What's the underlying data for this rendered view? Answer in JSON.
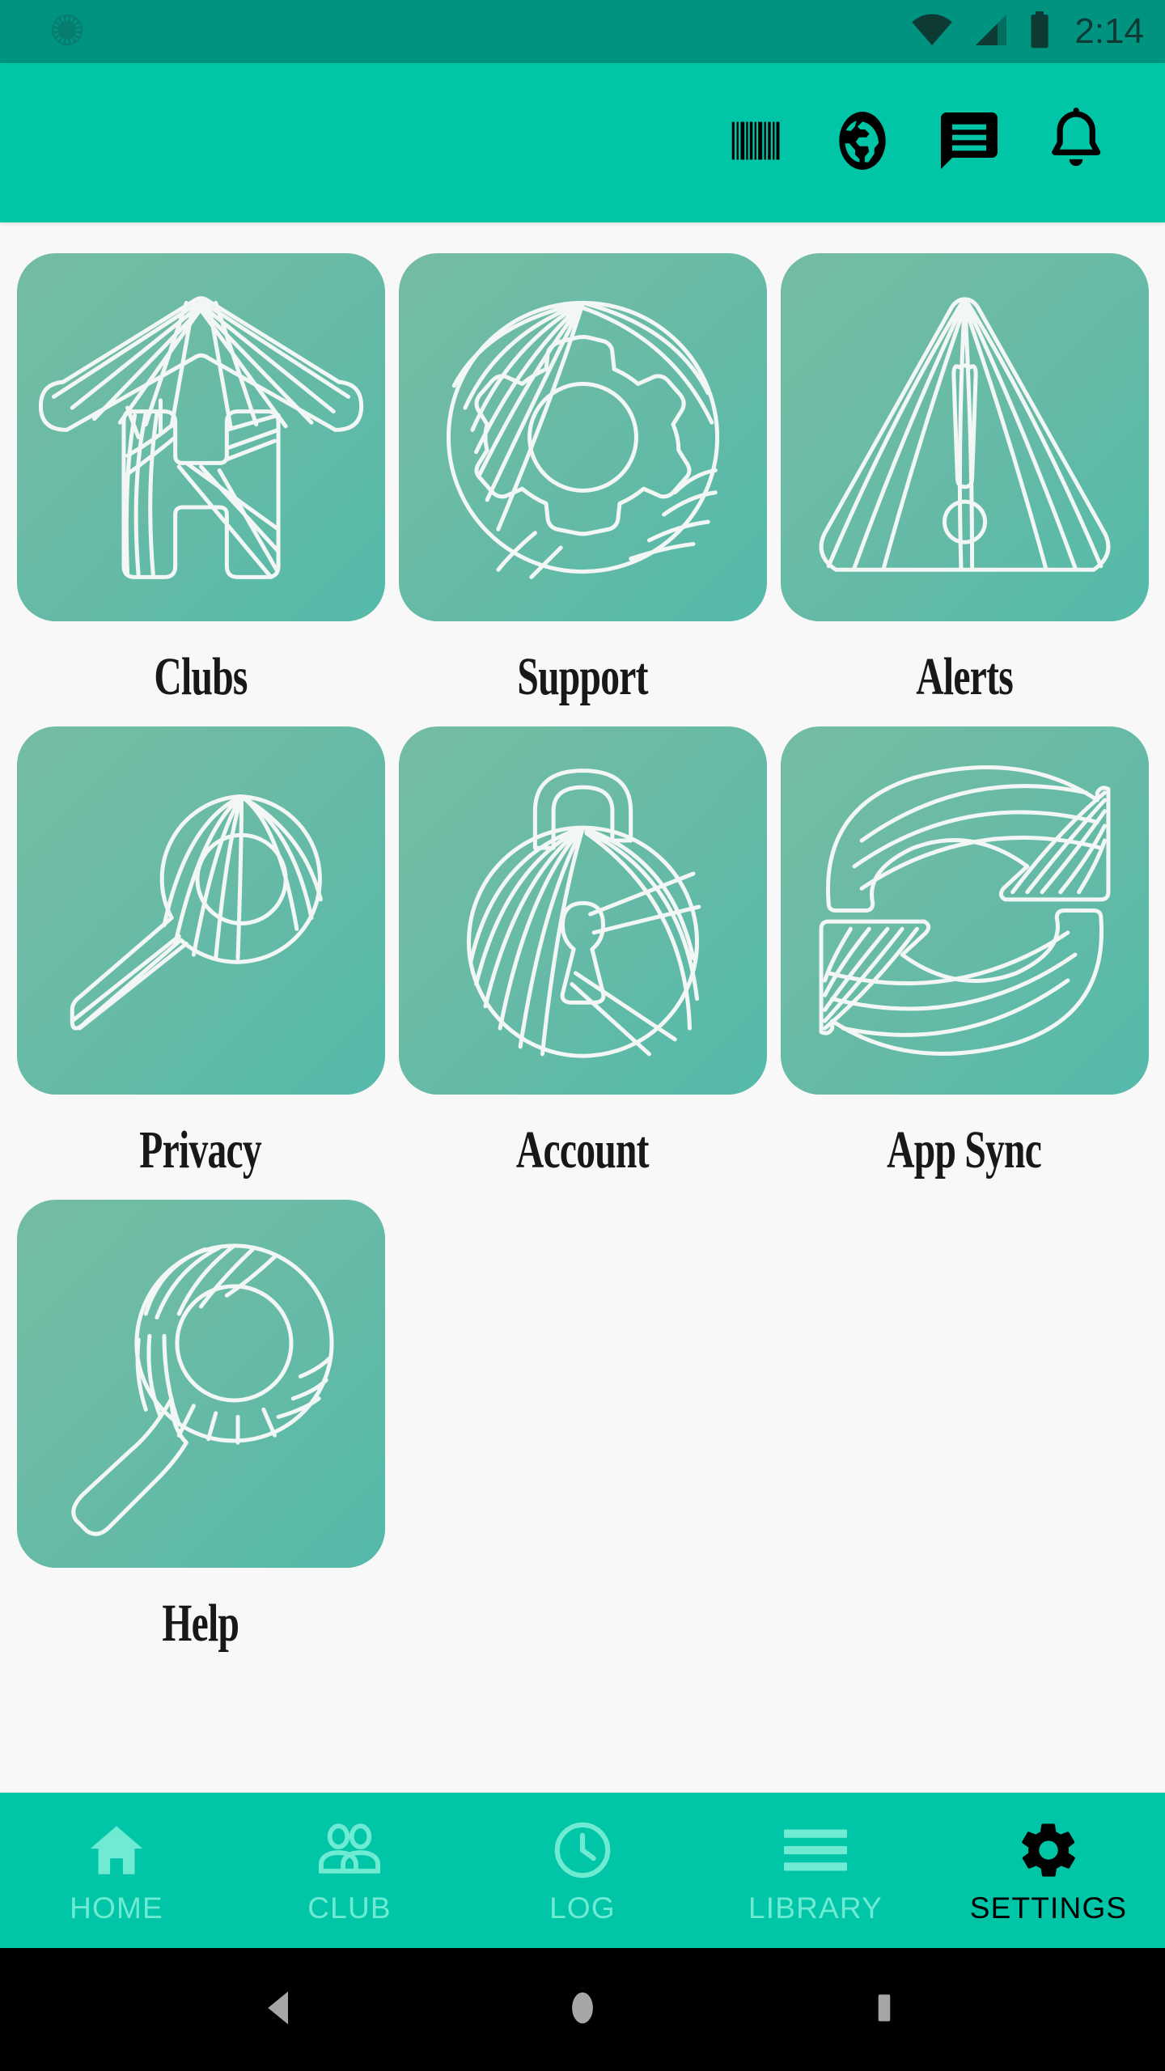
{
  "status_bar": {
    "time": "2:14",
    "background": "#009380",
    "icons": {
      "notification": "sync-circle-icon",
      "wifi": "wifi-icon",
      "signal": "cell-signal-icon",
      "battery": "battery-full-icon"
    }
  },
  "toolbar": {
    "background": "#00C6A7",
    "actions": [
      {
        "name": "barcode-icon",
        "label": "Barcode"
      },
      {
        "name": "globe-icon",
        "label": "Public"
      },
      {
        "name": "chat-icon",
        "label": "Messages"
      },
      {
        "name": "bell-icon",
        "label": "Notifications"
      }
    ]
  },
  "content": {
    "background": "#F7F8F7",
    "tile_gradient_from": "#74BCA3",
    "tile_gradient_to": "#55B9A9",
    "tiles": [
      {
        "label": "Clubs",
        "icon": "house-icon"
      },
      {
        "label": "Support",
        "icon": "gear-icon"
      },
      {
        "label": "Alerts",
        "icon": "warning-triangle-icon"
      },
      {
        "label": "Privacy",
        "icon": "key-icon"
      },
      {
        "label": "Account",
        "icon": "padlock-icon"
      },
      {
        "label": "App Sync",
        "icon": "sync-arrows-icon"
      },
      {
        "label": "Help",
        "icon": "magnifier-icon"
      }
    ]
  },
  "bottom_nav": {
    "background": "#00C6A7",
    "inactive_color": "#6FEBD4",
    "active_color": "#000000",
    "items": [
      {
        "label": "HOME",
        "icon": "home-icon",
        "active": false
      },
      {
        "label": "CLUB",
        "icon": "people-icon",
        "active": false
      },
      {
        "label": "LOG",
        "icon": "clock-icon",
        "active": false
      },
      {
        "label": "LIBRARY",
        "icon": "list-icon",
        "active": false
      },
      {
        "label": "SETTINGS",
        "icon": "gear-icon",
        "active": true
      }
    ]
  },
  "system_nav": {
    "background": "#000000",
    "buttons": [
      {
        "name": "back-button",
        "icon": "triangle-back-icon"
      },
      {
        "name": "home-button",
        "icon": "circle-home-icon"
      },
      {
        "name": "recents-button",
        "icon": "square-recents-icon"
      }
    ]
  }
}
